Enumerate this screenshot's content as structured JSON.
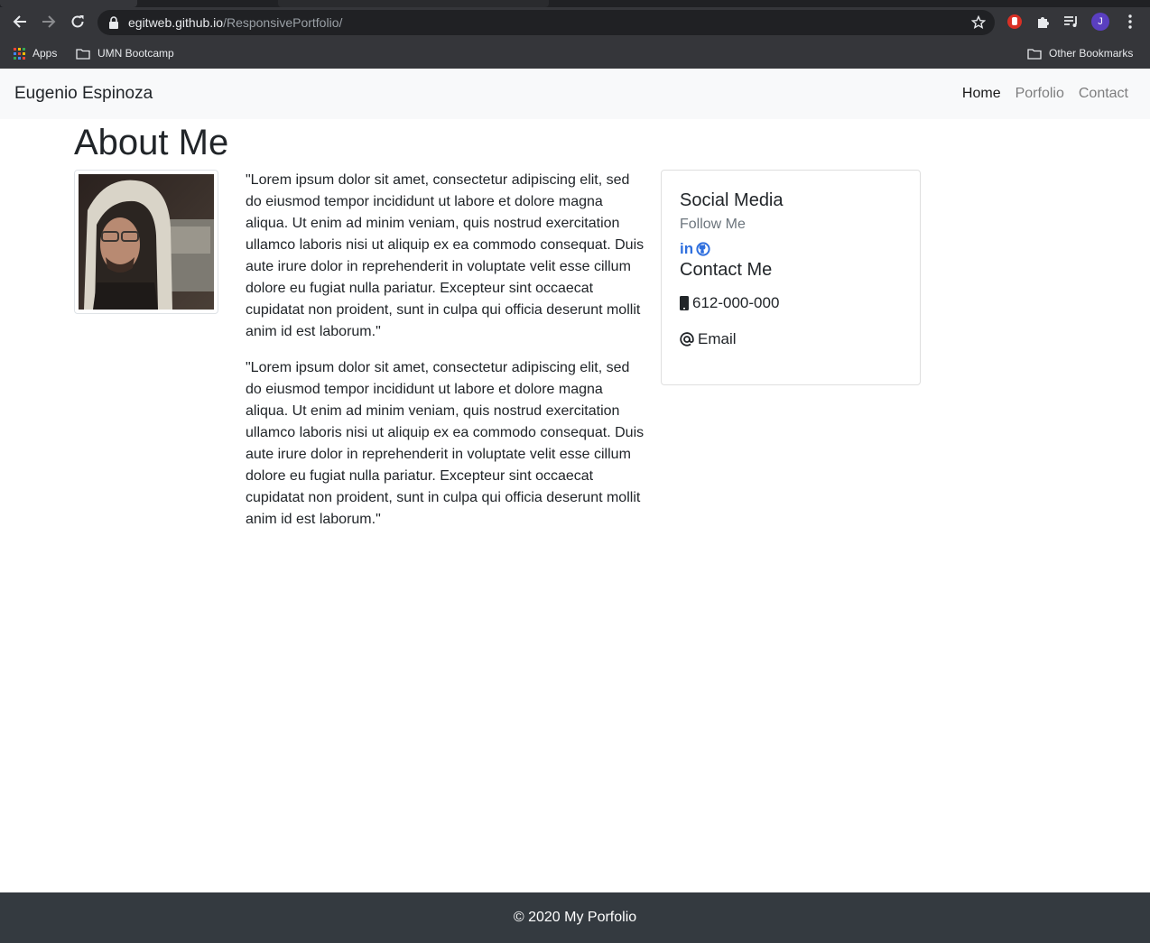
{
  "browser": {
    "url_host": "egitweb.github.io",
    "url_path": "/ResponsivePortfolio/",
    "profile_initial": "J",
    "bookmarks": {
      "apps_label": "Apps",
      "folder_label": "UMN Bootcamp",
      "other_label": "Other Bookmarks"
    }
  },
  "navbar": {
    "brand": "Eugenio Espinoza",
    "links": [
      {
        "label": "Home",
        "active": true
      },
      {
        "label": "Porfolio",
        "active": false
      },
      {
        "label": "Contact",
        "active": false
      }
    ]
  },
  "main": {
    "heading": "About Me",
    "paragraphs": [
      "\"Lorem ipsum dolor sit amet, consectetur adipiscing elit, sed do eiusmod tempor incididunt ut labore et dolore magna aliqua. Ut enim ad minim veniam, quis nostrud exercitation ullamco laboris nisi ut aliquip ex ea commodo consequat. Duis aute irure dolor in reprehenderit in voluptate velit esse cillum dolore eu fugiat nulla pariatur. Excepteur sint occaecat cupidatat non proident, sunt in culpa qui officia deserunt mollit anim id est laborum.\"",
      "\"Lorem ipsum dolor sit amet, consectetur adipiscing elit, sed do eiusmod tempor incididunt ut labore et dolore magna aliqua. Ut enim ad minim veniam, quis nostrud exercitation ullamco laboris nisi ut aliquip ex ea commodo consequat. Duis aute irure dolor in reprehenderit in voluptate velit esse cillum dolore eu fugiat nulla pariatur. Excepteur sint occaecat cupidatat non proident, sunt in culpa qui officia deserunt mollit anim id est laborum.\""
    ]
  },
  "card": {
    "title": "Social Media",
    "subtitle": "Follow Me",
    "linkedin_icon_text": "in",
    "contact_title": "Contact Me",
    "phone": "612-000-000",
    "email": "Email"
  },
  "footer": {
    "text": "© 2020 My Porfolio"
  },
  "icons": {
    "linkedin": "linkedin-icon",
    "github": "github-icon",
    "phone": "mobile-phone-icon",
    "email": "at-sign-icon"
  },
  "colors": {
    "link_blue": "#2f6fde",
    "navbar_bg": "#f8f9fa",
    "footer_bg": "#343a40"
  }
}
